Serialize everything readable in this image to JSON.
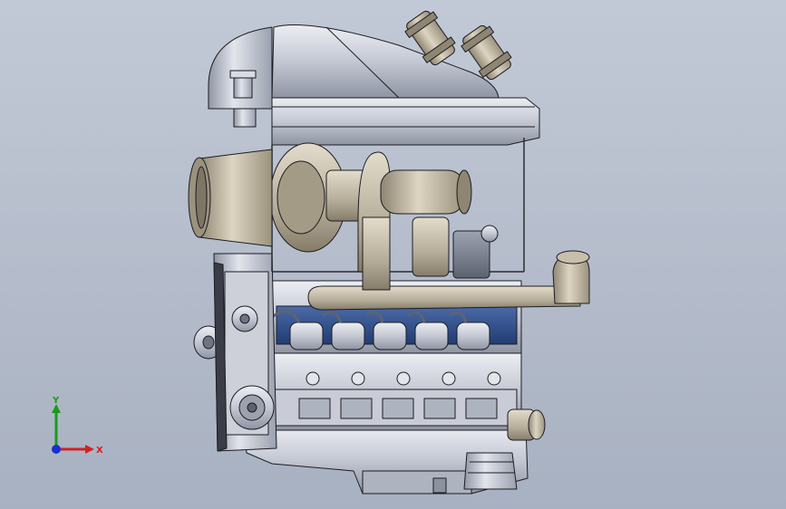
{
  "triad": {
    "x_label": "X",
    "y_label": "Y",
    "x_color": "#d42020",
    "y_color": "#1a9a1a",
    "z_color": "#1a2fd0"
  },
  "palette": {
    "background_top": "#c2c9d6",
    "background_bottom": "#a8b1c1",
    "metal_light": "#e6e8ee",
    "metal_mid": "#b9bdca",
    "metal_dark": "#6f7484",
    "bronze_light": "#d8d0bc",
    "bronze_dark": "#8e8572",
    "valley_blue": "#2f4f8f",
    "edge": "#1c1d22"
  }
}
